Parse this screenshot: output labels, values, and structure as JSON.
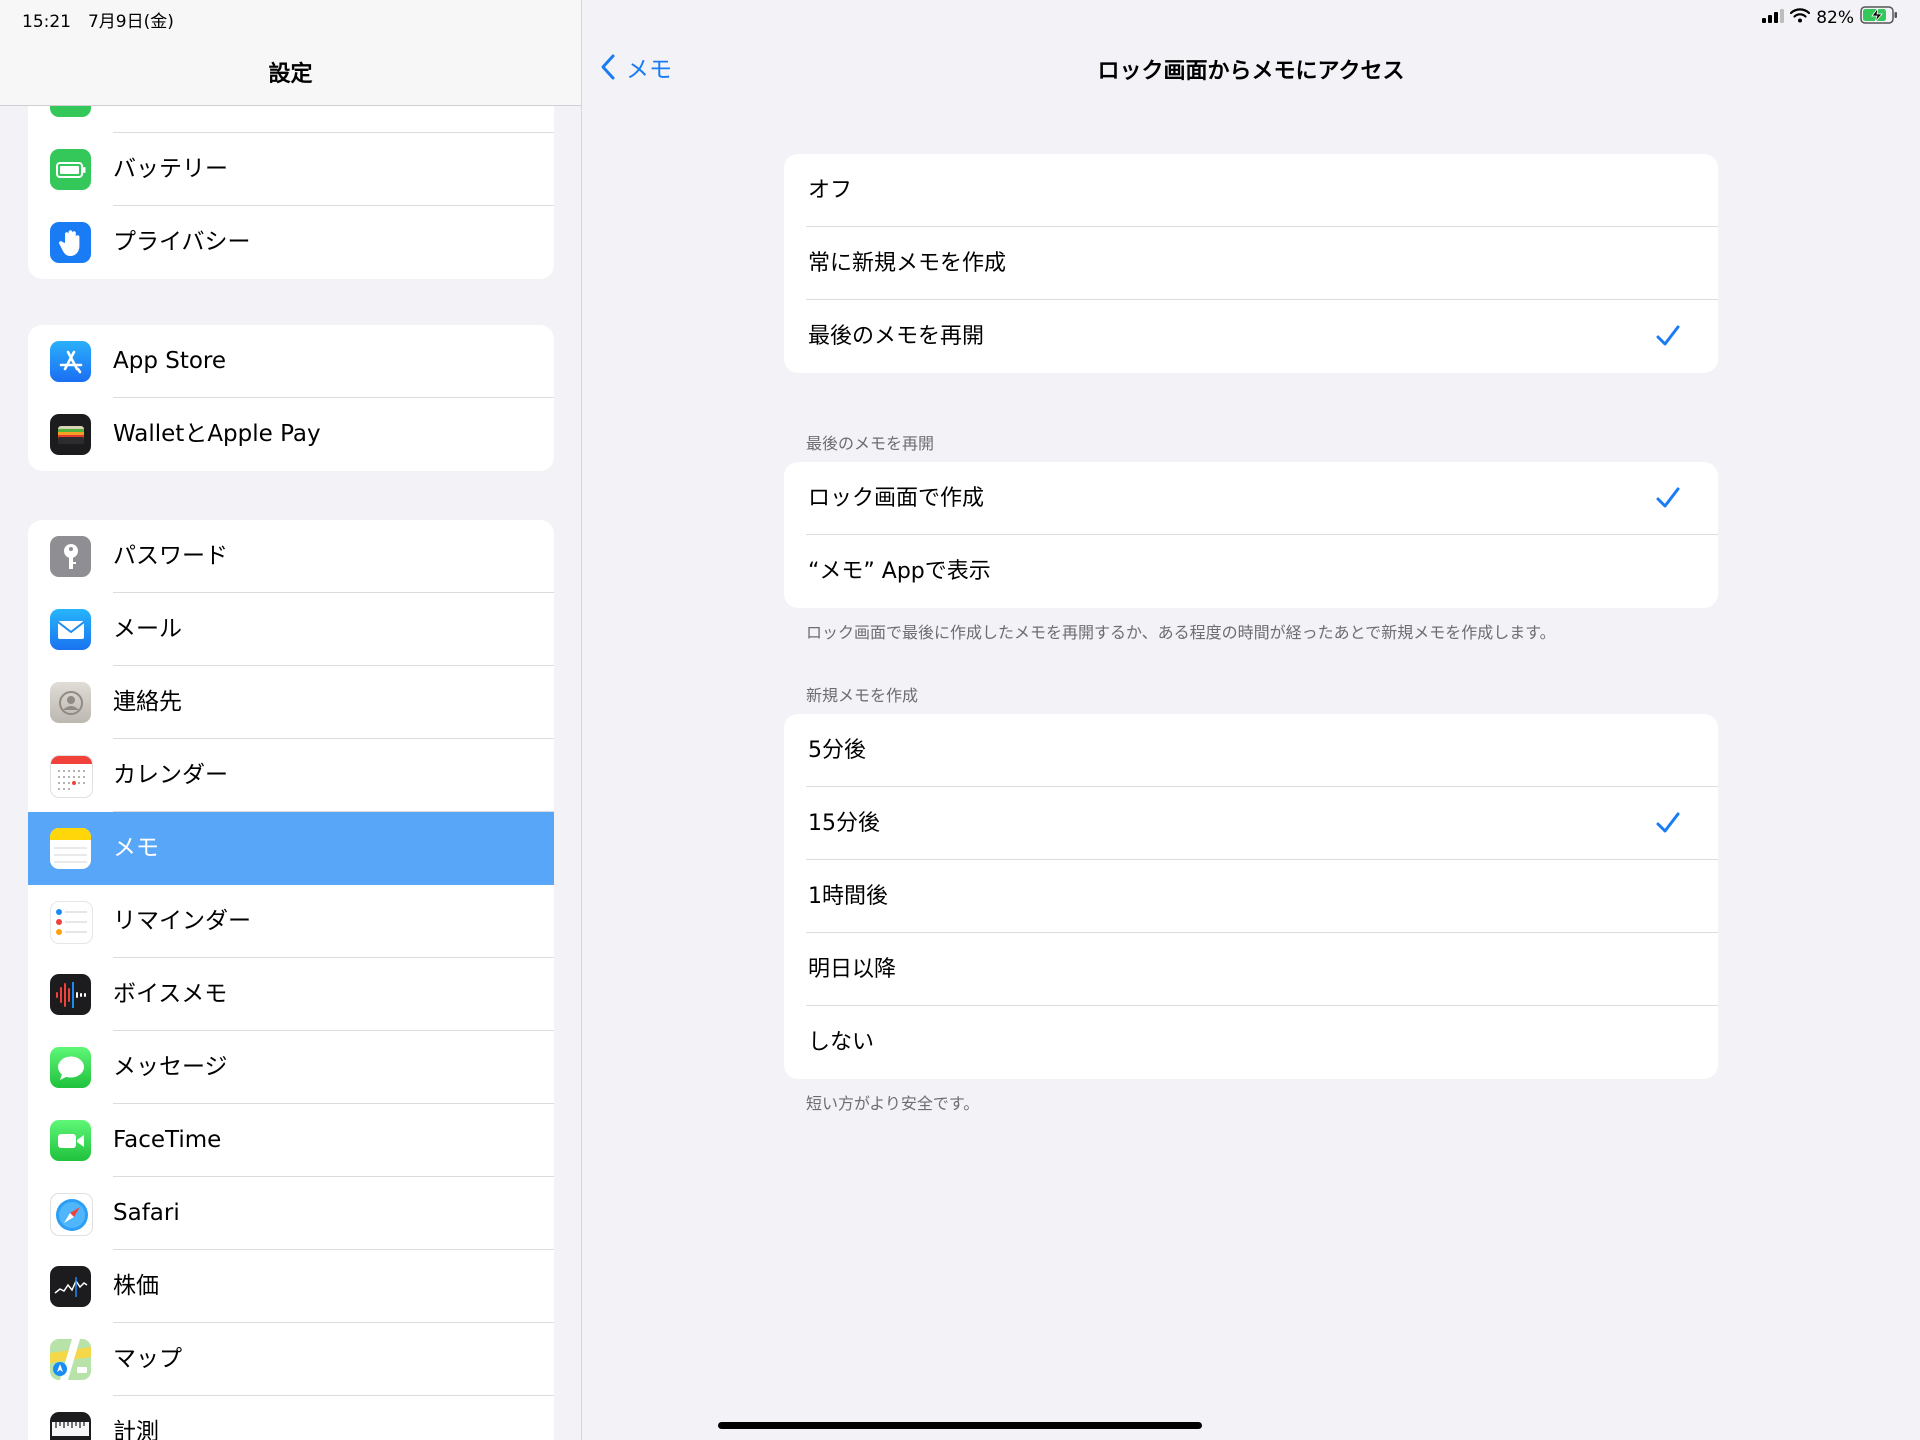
{
  "status": {
    "time_date": "15:21　7月9日(金)",
    "battery_percent": "82%",
    "battery_level": 0.82
  },
  "sidebar": {
    "title": "設定",
    "groups": [
      {
        "items": [
          {
            "label": "",
            "icon": "partial-green-icon",
            "color": "#34c759"
          },
          {
            "label": "バッテリー",
            "icon": "battery-icon",
            "color": "#34c759"
          },
          {
            "label": "プライバシー",
            "icon": "hand-icon",
            "color": "#1a7cf5"
          }
        ]
      },
      {
        "items": [
          {
            "label": "App Store",
            "icon": "app-store-icon",
            "color": "#1a8cf5"
          },
          {
            "label": "WalletとApple Pay",
            "icon": "wallet-icon",
            "color": "#1c1c1e"
          }
        ]
      },
      {
        "items": [
          {
            "label": "パスワード",
            "icon": "key-icon",
            "color": "#8e8e93"
          },
          {
            "label": "メール",
            "icon": "mail-icon",
            "color": "#1a8cf5"
          },
          {
            "label": "連絡先",
            "icon": "contacts-icon",
            "color": "#c9c9c9"
          },
          {
            "label": "カレンダー",
            "icon": "calendar-icon",
            "color": "#ffffff"
          },
          {
            "label": "メモ",
            "icon": "notes-icon",
            "color": "#ffd60a",
            "selected": true
          },
          {
            "label": "リマインダー",
            "icon": "reminders-icon",
            "color": "#ffffff"
          },
          {
            "label": "ボイスメモ",
            "icon": "voice-memo-icon",
            "color": "#1c1c1e"
          },
          {
            "label": "メッセージ",
            "icon": "messages-icon",
            "color": "#34c759"
          },
          {
            "label": "FaceTime",
            "icon": "facetime-icon",
            "color": "#34c759"
          },
          {
            "label": "Safari",
            "icon": "safari-icon",
            "color": "#1a8cf5"
          },
          {
            "label": "株価",
            "icon": "stocks-icon",
            "color": "#1c1c1e"
          },
          {
            "label": "マップ",
            "icon": "maps-icon",
            "color": "#7ad16e"
          },
          {
            "label": "計測",
            "icon": "measure-icon",
            "color": "#1c1c1e"
          }
        ]
      }
    ]
  },
  "main": {
    "back_label": "メモ",
    "title": "ロック画面からメモにアクセス",
    "section1": {
      "options": [
        {
          "label": "オフ",
          "checked": false
        },
        {
          "label": "常に新規メモを作成",
          "checked": false
        },
        {
          "label": "最後のメモを再開",
          "checked": true
        }
      ]
    },
    "section2": {
      "header": "最後のメモを再開",
      "options": [
        {
          "label": "ロック画面で作成",
          "checked": true
        },
        {
          "label": "“メモ” Appで表示",
          "checked": false
        }
      ],
      "footer": "ロック画面で最後に作成したメモを再開するか、ある程度の時間が経ったあとで新規メモを作成します。"
    },
    "section3": {
      "header": "新規メモを作成",
      "options": [
        {
          "label": "5分後",
          "checked": false
        },
        {
          "label": "15分後",
          "checked": true
        },
        {
          "label": "1時間後",
          "checked": false
        },
        {
          "label": "明日以降",
          "checked": false
        },
        {
          "label": "しない",
          "checked": false
        }
      ],
      "footer": "短い方がより安全です。"
    }
  },
  "colors": {
    "accent": "#1a7cf5",
    "selected_row": "#58a6f8",
    "background": "#f2f2f7"
  }
}
